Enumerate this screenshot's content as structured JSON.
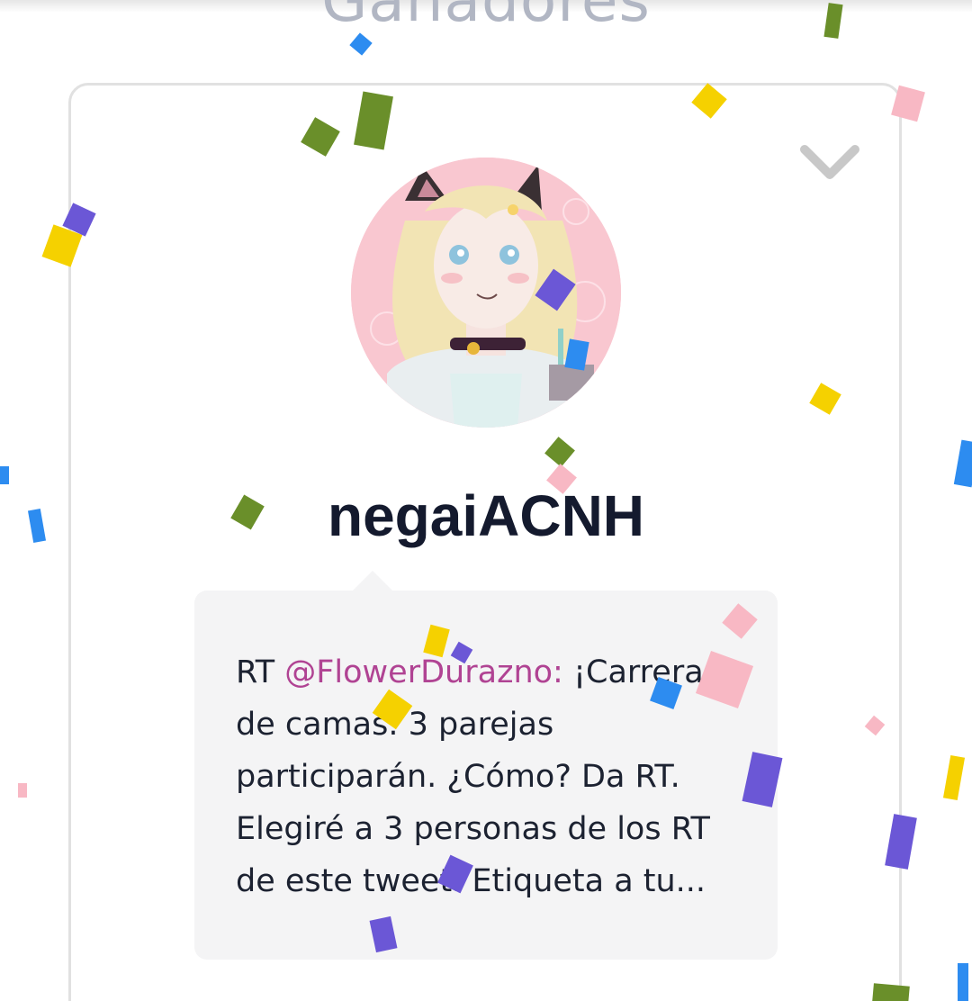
{
  "section": {
    "title": "Ganadores"
  },
  "winner": {
    "username": "negaiACNH",
    "tweet": {
      "prefix": "RT ",
      "mention": "@FlowerDurazno:",
      "text": " ¡Carrera de camas. 3 parejas participarán. ¿Cómo? Da RT. Elegiré a 3 personas de los RT de este tweet. Etiqueta a tu..."
    }
  },
  "icons": {
    "collapse": "chevron-down-icon",
    "avatar": "anime-girl-avatar"
  },
  "colors": {
    "title": "#b1b6c3",
    "username": "#141a2e",
    "mention": "#b04393",
    "bubble": "#f4f4f5",
    "card_border": "#e1e1e1"
  }
}
